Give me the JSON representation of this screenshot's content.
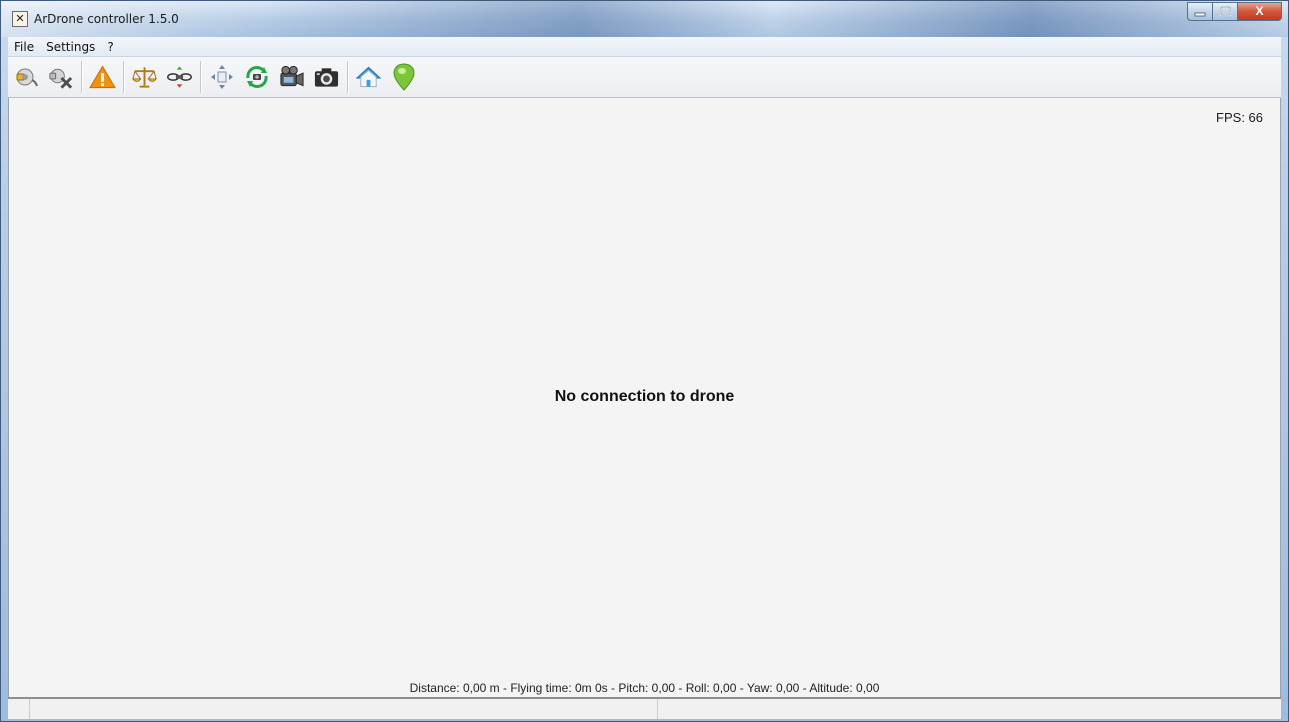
{
  "window": {
    "title": "ArDrone controller 1.5.0",
    "app_icon": "ardrone-app-icon",
    "controls": {
      "minimize": "–",
      "maximize": "□",
      "close": "X"
    }
  },
  "menu": {
    "items": [
      "File",
      "Settings",
      "?"
    ]
  },
  "toolbar": {
    "buttons": [
      {
        "icon": "connect-plug-icon"
      },
      {
        "icon": "disconnect-plug-icon"
      },
      {
        "icon": "emergency-warning-icon"
      },
      {
        "icon": "flat-trim-balance-icon"
      },
      {
        "icon": "drone-altitude-icon"
      },
      {
        "icon": "move-arrows-icon"
      },
      {
        "icon": "switch-camera-icon"
      },
      {
        "icon": "video-camera-icon"
      },
      {
        "icon": "photo-camera-icon"
      },
      {
        "icon": "home-icon"
      },
      {
        "icon": "map-pin-icon"
      }
    ]
  },
  "video": {
    "fps": "FPS: 66",
    "message": "No connection to drone",
    "telemetry": "Distance: 0,00 m - Flying time: 0m 0s - Pitch: 0,00 - Roll: 0,00 - Yaw: 0,00 - Altitude: 0,00"
  },
  "colors": {
    "warning": "#f29111",
    "pin": "#7cc63a",
    "home": "#3a9ee0",
    "close_button": "#c9432a"
  }
}
